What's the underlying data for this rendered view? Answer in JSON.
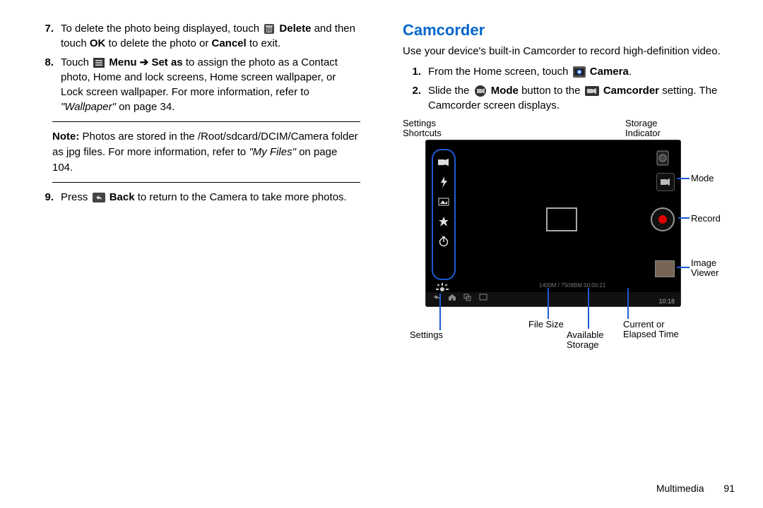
{
  "left": {
    "item7_a": "To delete the photo being displayed, touch ",
    "item7_b": " Delete",
    "item7_c": " and then touch ",
    "item7_d": "OK",
    "item7_e": " to delete the photo or ",
    "item7_f": "Cancel",
    "item7_g": " to exit.",
    "item8_a": "Touch ",
    "item8_b": " Menu ➔ Set as",
    "item8_c": " to assign the photo as a Contact photo, Home and lock screens, Home screen wallpaper, or Lock screen wallpaper. For more information, refer to ",
    "item8_d": "\"Wallpaper\"",
    "item8_e": "  on page 34.",
    "note_label": "Note:",
    "note_a": " Photos are stored in the /Root/sdcard/DCIM/Camera folder as jpg files. For more information, refer to ",
    "note_b": "\"My Files\"",
    "note_c": "  on page 104.",
    "item9_a": "Press ",
    "item9_b": " Back",
    "item9_c": " to return to the Camera to take more photos."
  },
  "right": {
    "head": "Camcorder",
    "intro": "Use your device's built-in Camcorder to record high-definition video.",
    "s1_a": "From the Home screen, touch ",
    "s1_b": " Camera",
    "s1_c": ".",
    "s2_a": "Slide the ",
    "s2_b": " Mode",
    "s2_c": " button to the ",
    "s2_d": " Camcorder",
    "s2_e": " setting. The Camcorder screen displays."
  },
  "labels": {
    "settings_shortcuts": "Settings\nShortcuts",
    "storage_indicator": "Storage\nIndicator",
    "mode": "Mode",
    "record": "Record",
    "image_viewer": "Image\nViewer",
    "settings": "Settings",
    "file_size": "File Size",
    "available_storage": "Available\nStorage",
    "elapsed": "Current or\nElapsed Time"
  },
  "device": {
    "overlay_info": "1400M / 7508BM      00:00:21",
    "clock": "10:18"
  },
  "footer": {
    "chapter": "Multimedia",
    "page": "91"
  },
  "nums": {
    "n7": "7.",
    "n8": "8.",
    "n9": "9.",
    "n1": "1.",
    "n2": "2."
  }
}
